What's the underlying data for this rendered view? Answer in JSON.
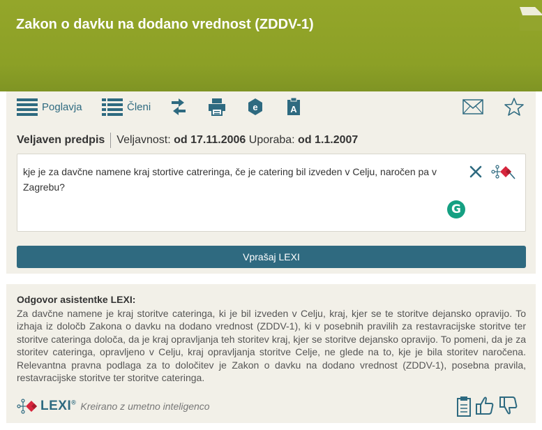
{
  "header": {
    "title": "Zakon o davku na dodano vrednost (ZDDV-1)"
  },
  "toolbar": {
    "chapters_label": "Poglavja",
    "articles_label": "Členi"
  },
  "validity": {
    "status": "Veljaven predpis",
    "validity_label": "Veljavnost:",
    "validity_value": "od 17.11.2006",
    "use_label": "Uporaba:",
    "use_value": "od 1.1.2007"
  },
  "query": {
    "text": "kje je za davčne namene kraj stortive catreringa, če je catering bil izveden v Celju, naročen pa v Zagrebu?",
    "assistant_badge_letter": "G"
  },
  "ask_button": {
    "label": "Vprašaj LEXI"
  },
  "answer": {
    "heading": "Odgovor asistentke LEXI:",
    "body": "Za davčne namene je kraj storitve cateringa, ki je bil izveden v Celju, kraj, kjer se te storitve dejansko opravijo. To izhaja iz določb Zakona o davku na dodano vrednost (ZDDV-1), ki v posebnih pravilih za restavracijske storitve ter storitve cateringa določa, da je kraj opravljanja teh storitev kraj, kjer se storitve dejansko opravijo. To pomeni, da je za storitev cateringa, opravljeno v Celju, kraj opravljanja storitve Celje, ne glede na to, kje je bila storitev naročena. Relevantna pravna podlaga za to določitev je Zakon o davku na dodano vrednost (ZDDV-1), posebna pravila, restavracijske storitve ter storitve cateringa.",
    "brand": "LEXI",
    "brand_mark": "®",
    "caption": "Kreirano z umetno inteligenco"
  },
  "colors": {
    "header": "#8ca026",
    "accent": "#2f6a80",
    "panel": "#f2f0e8",
    "lexi_red": "#d7263d"
  },
  "icons": [
    "list-icon",
    "swap-icon",
    "print-icon",
    "epub-icon",
    "font-size-icon",
    "mail-icon",
    "star-icon",
    "close-icon",
    "lexi-icon",
    "grammarly-icon",
    "clipboard-icon",
    "thumbs-up-icon",
    "thumbs-down-icon"
  ]
}
